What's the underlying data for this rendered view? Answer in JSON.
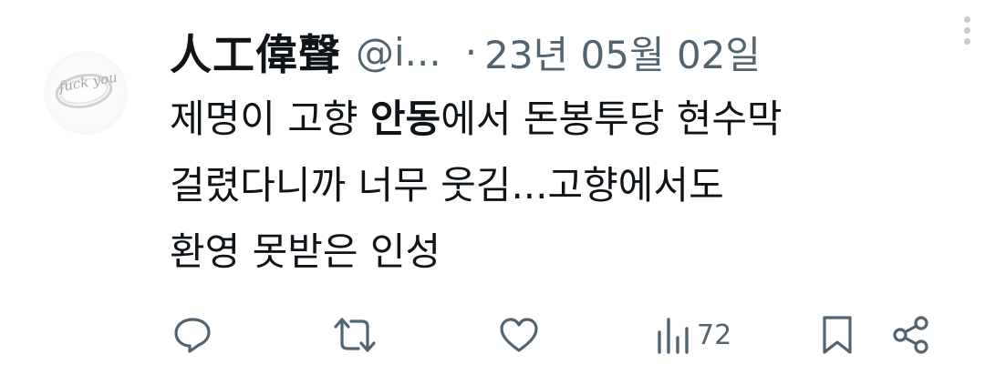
{
  "tweet": {
    "author_name": "人工偉聲",
    "handle": "@i...",
    "separator": "·",
    "date": "23년 05월 02일",
    "body": {
      "line1_pre": "제명이 고향 ",
      "line1_bold": "안동",
      "line1_post": "에서 돈봉투당 현수막",
      "line2": "걸렸다니까 너무 웃김...고향에서도",
      "line3": "환영 못받은 인성"
    },
    "avatar_text": "fuck you"
  },
  "actions": {
    "reply_icon": "reply-icon",
    "retweet_icon": "retweet-icon",
    "like_icon": "heart-icon",
    "views_icon": "views-chart-icon",
    "views_count": "72",
    "bookmark_icon": "bookmark-icon",
    "share_icon": "share-icon"
  },
  "colors": {
    "text": "#0f1419",
    "secondary": "#536471"
  }
}
